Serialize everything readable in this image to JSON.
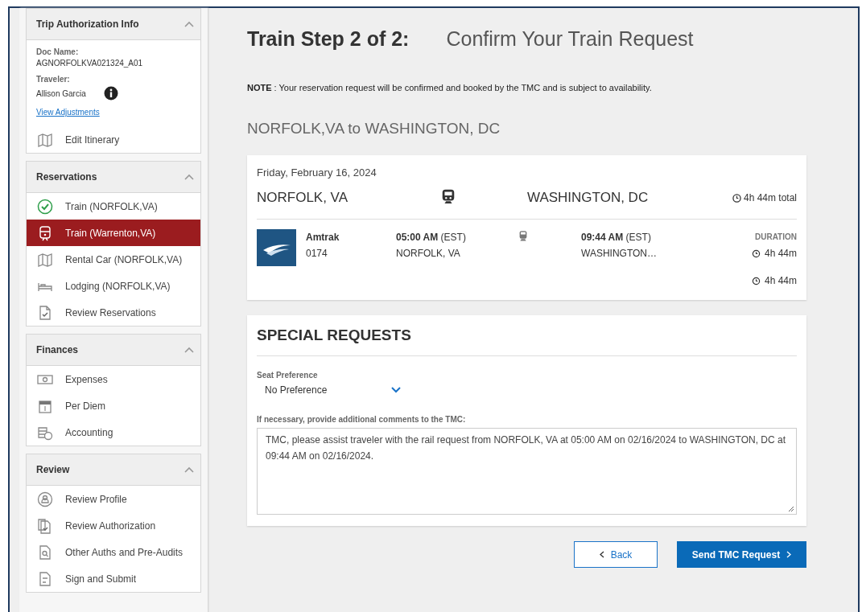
{
  "sidebar": {
    "sections": [
      {
        "title": "Trip Authorization Info",
        "expanded": true,
        "info": {
          "doc_label": "Doc Name:",
          "doc_value": "AGNORFOLKVA021324_A01",
          "traveler_label": "Traveler:",
          "traveler_value": "Allison Garcia",
          "link": "View Adjustments"
        },
        "items": [
          {
            "label": "Edit Itinerary",
            "kind": "map",
            "selected": false
          }
        ]
      },
      {
        "title": "Reservations",
        "expanded": true,
        "items": [
          {
            "label": "Train (NORFOLK,VA)",
            "kind": "check",
            "selected": false
          },
          {
            "label": "Train (Warrenton,VA)",
            "kind": "train",
            "selected": true
          },
          {
            "label": "Rental Car (NORFOLK,VA)",
            "kind": "map",
            "selected": false
          },
          {
            "label": "Lodging (NORFOLK,VA)",
            "kind": "bed",
            "selected": false
          },
          {
            "label": "Review Reservations",
            "kind": "doccheck",
            "selected": false
          }
        ]
      },
      {
        "title": "Finances",
        "expanded": true,
        "items": [
          {
            "label": "Expenses",
            "kind": "money",
            "selected": false
          },
          {
            "label": "Per Diem",
            "kind": "calendar",
            "selected": false
          },
          {
            "label": "Accounting",
            "kind": "coins",
            "selected": false
          }
        ]
      },
      {
        "title": "Review",
        "expanded": true,
        "items": [
          {
            "label": "Review Profile",
            "kind": "profile",
            "selected": false
          },
          {
            "label": "Review Authorization",
            "kind": "pages",
            "selected": false
          },
          {
            "label": "Other Auths and Pre-Audits",
            "kind": "search",
            "selected": false
          },
          {
            "label": "Sign and Submit",
            "kind": "form",
            "selected": false
          }
        ]
      }
    ]
  },
  "main": {
    "step": "Train Step 2 of 2:",
    "heading": "Confirm Your Train Request",
    "note_label": "NOTE",
    "note": ": Your reservation request will be confirmed and booked by the TMC and is subject to availability.",
    "route": "NORFOLK,VA to WASHINGTON, DC",
    "trip": {
      "date": "Friday, February 16, 2024",
      "origin": "NORFOLK, VA",
      "destination": "WASHINGTON, DC",
      "total": "4h 44m total",
      "segment": {
        "carrier": "Amtrak",
        "number": "0174",
        "depart_time": "05:00 AM",
        "depart_zone": "(EST)",
        "depart_city": "NORFOLK, VA",
        "arrive_time": "09:44 AM",
        "arrive_zone": "(EST)",
        "arrive_city": "WASHINGTON…",
        "duration_label": "DURATION",
        "durations": [
          "4h 44m",
          "4h 44m"
        ]
      }
    },
    "special": {
      "title": "SPECIAL REQUESTS",
      "seat_label": "Seat Preference",
      "seat_value": "No Preference",
      "comments_label": "If necessary, provide additional comments to the TMC:",
      "comments": "TMC, please assist traveler with the rail request from NORFOLK, VA at 05:00 AM on 02/16/2024 to WASHINGTON, DC at 09:44 AM on 02/16/2024."
    },
    "buttons": [
      {
        "label": "Back",
        "kind": "back"
      },
      {
        "label": "Send TMC Request",
        "kind": "next"
      }
    ]
  }
}
